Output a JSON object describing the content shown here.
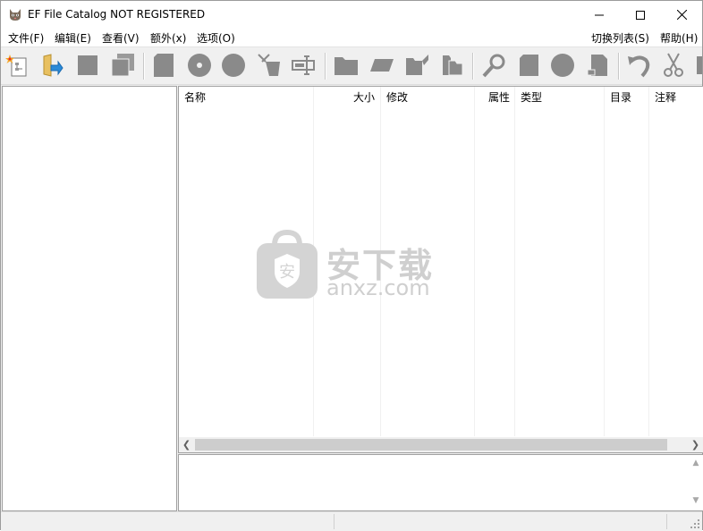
{
  "window": {
    "title": "EF File Catalog NOT REGISTERED"
  },
  "menu": {
    "left": [
      {
        "label": "文件(F)"
      },
      {
        "label": "编辑(E)"
      },
      {
        "label": "查看(V)"
      },
      {
        "label": "额外(x)"
      },
      {
        "label": "选项(O)"
      }
    ],
    "right": [
      {
        "label": "切换列表(S)"
      },
      {
        "label": "帮助(H)"
      }
    ]
  },
  "toolbar": {
    "icons": [
      "new-catalog-icon",
      "open-folder-icon",
      "square-icon",
      "copy-pages-icon",
      "disk-icon",
      "cd-icon",
      "circle-icon",
      "scan-fork-icon",
      "rename-icon",
      "folder-gray-icon",
      "tape-icon",
      "folder-edit-icon",
      "folder-stack-icon",
      "search-icon",
      "document-icon",
      "globe-icon",
      "export-icon",
      "undo-icon",
      "cut-icon",
      "next-icon"
    ]
  },
  "list": {
    "columns": [
      {
        "label": "名称"
      },
      {
        "label": "大小"
      },
      {
        "label": "修改"
      },
      {
        "label": "属性"
      },
      {
        "label": "类型"
      },
      {
        "label": "目录"
      },
      {
        "label": "注释"
      }
    ]
  },
  "watermark": {
    "title": "安下载",
    "subtitle": "anxz.com"
  },
  "colors": {
    "window_bg": "#f0f0f0",
    "panel_bg": "#ffffff",
    "icon_gray": "#8a8a8a",
    "watermark": "#cfcfcf"
  }
}
